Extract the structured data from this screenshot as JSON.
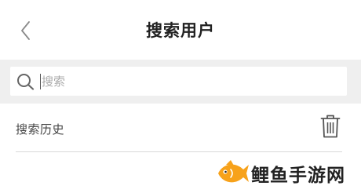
{
  "header": {
    "back_icon": "chevron-left-icon",
    "title": "搜索用户"
  },
  "search": {
    "icon": "search-icon",
    "placeholder": "搜索",
    "value": ""
  },
  "history": {
    "label": "搜索历史",
    "clear_icon": "trash-icon"
  },
  "watermark": {
    "text": "鲤鱼手游网",
    "logo_color": "#f7a21b"
  },
  "colors": {
    "search_band": "#efefef",
    "title_text": "#222222",
    "divider": "#d9d9d9"
  }
}
